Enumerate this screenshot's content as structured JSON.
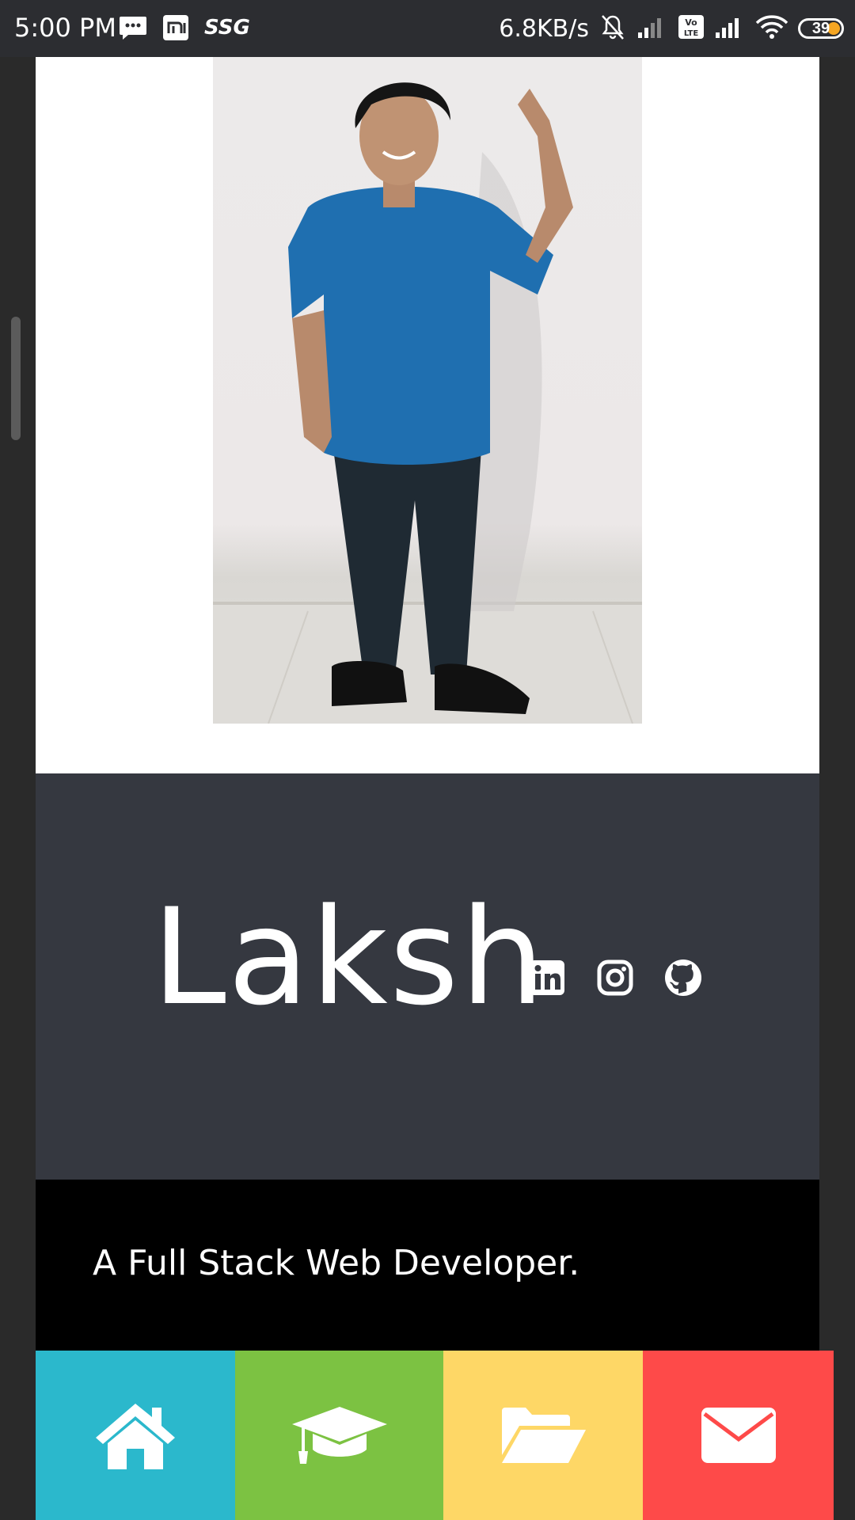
{
  "status_bar": {
    "time": "5:00 PM",
    "ssg_label": "SSG",
    "net_speed": "6.8KB/s",
    "battery": "39"
  },
  "profile": {
    "name": "Laksh",
    "tagline": "A Full Stack Web Developer."
  },
  "social": [
    "linkedin-icon",
    "instagram-icon",
    "github-icon"
  ],
  "nav": [
    {
      "icon": "home-icon",
      "color": "#2bb8cc"
    },
    {
      "icon": "graduation-cap-icon",
      "color": "#7cc242"
    },
    {
      "icon": "folder-open-icon",
      "color": "#fed766"
    },
    {
      "icon": "envelope-icon",
      "color": "#fe4a49"
    }
  ],
  "colors": {
    "hero_bg": "#353840",
    "tagline_bg": "#000000",
    "status_bg": "#2c2d31"
  }
}
